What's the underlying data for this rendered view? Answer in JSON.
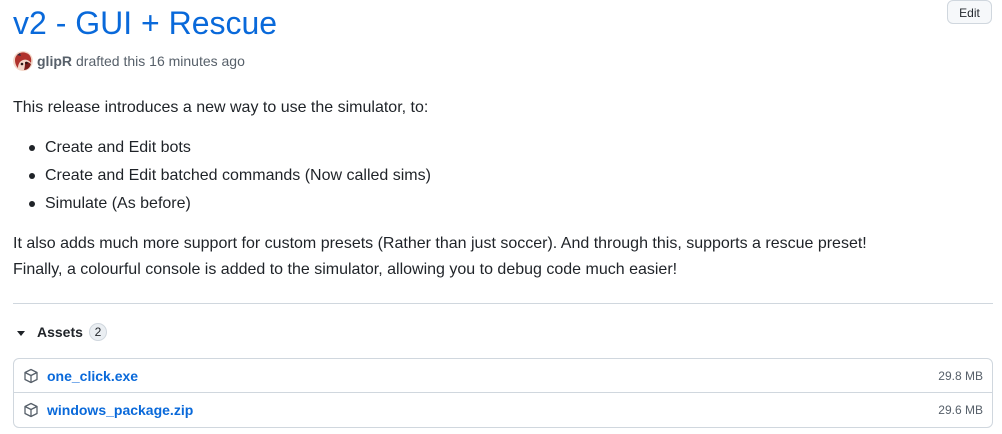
{
  "release": {
    "title": "v2 - GUI + Rescue",
    "edit_label": "Edit",
    "author": "glipR",
    "status_text": "drafted this 16 minutes ago"
  },
  "body": {
    "intro": "This release introduces a new way to use the simulator, to:",
    "bullets": [
      "Create and Edit bots",
      "Create and Edit batched commands (Now called sims)",
      "Simulate (As before)"
    ],
    "paragraph_line1": "It also adds much more support for custom presets (Rather than just soccer). And through this, supports a rescue preset!",
    "paragraph_line2": "Finally, a colourful console is added to the simulator, allowing you to debug code much easier!"
  },
  "assets": {
    "label": "Assets",
    "count": "2",
    "items": [
      {
        "name": "one_click.exe",
        "size": "29.8 MB",
        "icon": "package-icon"
      },
      {
        "name": "windows_package.zip",
        "size": "29.6 MB",
        "icon": "package-icon"
      }
    ]
  },
  "colors": {
    "link": "#0969da",
    "muted": "#57606a",
    "border": "#d0d7de"
  }
}
